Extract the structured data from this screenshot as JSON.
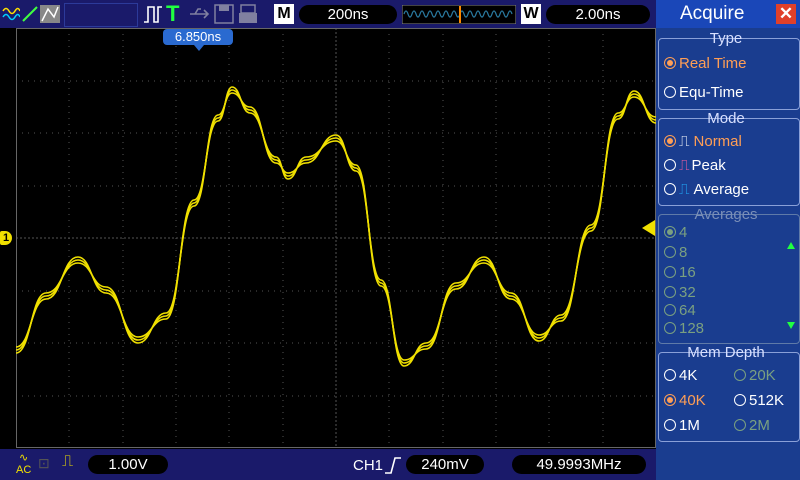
{
  "topbar": {
    "timebase": "200ns",
    "m_label": "M",
    "w_label": "W",
    "w_value": "2.00ns",
    "cursor_readout": "6.850ns",
    "trigger_icon_label": "T"
  },
  "bottombar": {
    "ch_scale": "1.00V",
    "ch_label": "CH1",
    "trigger_level": "240mV",
    "frequency": "49.9993MHz"
  },
  "menu": {
    "title": "Acquire",
    "type": {
      "header": "Type",
      "options": [
        "Real Time",
        "Equ-Time"
      ],
      "selected": 0
    },
    "mode": {
      "header": "Mode",
      "options": [
        "Normal",
        "Peak",
        "Average"
      ],
      "selected": 0
    },
    "averages": {
      "header": "Averages",
      "options": [
        "4",
        "8",
        "16",
        "32",
        "64",
        "128"
      ],
      "selected": 0
    },
    "mem_depth": {
      "header": "Mem Depth",
      "left": [
        "4K",
        "40K",
        "1M"
      ],
      "right": [
        "20K",
        "512K",
        "2M"
      ],
      "selected": "40K"
    }
  },
  "colors": {
    "trace": "#f0e000",
    "grid": "#555555",
    "menu_bg": "#1a3d8f",
    "bar_bg": "#1a1a6a",
    "select": "#ff9e55"
  }
}
